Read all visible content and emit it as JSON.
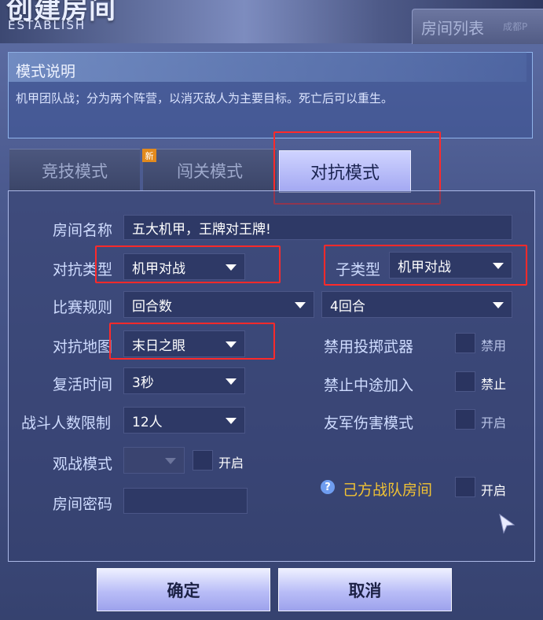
{
  "header": {
    "title": "创建房间",
    "subtitle": "ESTABLISH",
    "room_list_tab": "房间列表",
    "room_list_hint": "成都P"
  },
  "mode_desc": {
    "title": "模式说明",
    "text": "机甲团队战；分为两个阵营，以消灭敌人为主要目标。死亡后可以重生。"
  },
  "tabs": [
    {
      "label": "竞技模式",
      "active": false
    },
    {
      "label": "闯关模式",
      "active": false,
      "badge": "新"
    },
    {
      "label": "对抗模式",
      "active": true
    }
  ],
  "form": {
    "room_name": {
      "label": "房间名称",
      "value": "五大机甲，王牌对王牌!"
    },
    "battle_type": {
      "label": "对抗类型",
      "value": "机甲对战"
    },
    "sub_type": {
      "label": "子类型",
      "value": "机甲对战"
    },
    "match_rule": {
      "label": "比赛规则",
      "value": "回合数",
      "rounds": "4回合"
    },
    "map": {
      "label": "对抗地图",
      "value": "末日之眼"
    },
    "respawn": {
      "label": "复活时间",
      "value": "3秒"
    },
    "player_limit": {
      "label": "战斗人数限制",
      "value": "12人"
    },
    "spectate": {
      "label": "观战模式",
      "value": "",
      "toggle_label": "开启"
    },
    "password": {
      "label": "房间密码",
      "value": ""
    }
  },
  "options": {
    "ban_throw": {
      "label": "禁用投掷武器",
      "toggle_label": "禁用"
    },
    "no_join": {
      "label": "禁止中途加入",
      "toggle_label": "禁止"
    },
    "friendly_fire": {
      "label": "友军伤害模式",
      "toggle_label": "开启"
    },
    "team_room": {
      "label": "己方战队房间",
      "toggle_label": "开启",
      "help": "?"
    }
  },
  "buttons": {
    "confirm": "确定",
    "cancel": "取消"
  },
  "colors": {
    "highlight": "#ff2a2a",
    "team_room_label": "#f1c233",
    "active_tab": "#a3a8f2"
  }
}
